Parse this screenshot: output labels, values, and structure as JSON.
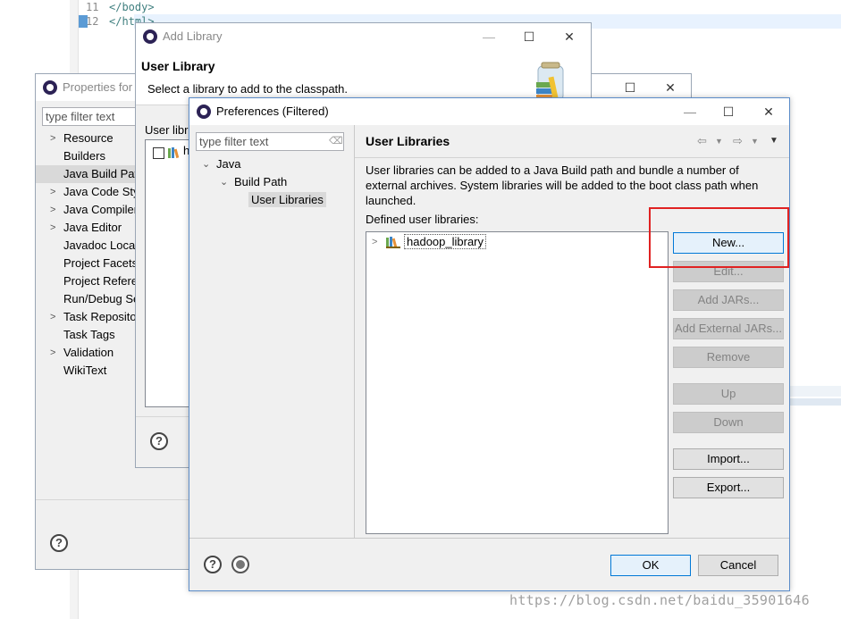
{
  "editor": {
    "lines": [
      {
        "num": "11",
        "code": "</body>"
      },
      {
        "num": "12",
        "code": "</html>"
      }
    ]
  },
  "properties": {
    "title": "Properties for",
    "filter_placeholder": "type filter text",
    "tree": [
      {
        "label": "Resource",
        "expandable": true
      },
      {
        "label": "Builders",
        "expandable": false
      },
      {
        "label": "Java Build Path",
        "expandable": false,
        "selected": true
      },
      {
        "label": "Java Code Style",
        "expandable": true
      },
      {
        "label": "Java Compiler",
        "expandable": true
      },
      {
        "label": "Java Editor",
        "expandable": true
      },
      {
        "label": "Javadoc Location",
        "expandable": false
      },
      {
        "label": "Project Facets",
        "expandable": false
      },
      {
        "label": "Project References",
        "expandable": false
      },
      {
        "label": "Run/Debug Settings",
        "expandable": false
      },
      {
        "label": "Task Repository",
        "expandable": true
      },
      {
        "label": "Task Tags",
        "expandable": false
      },
      {
        "label": "Validation",
        "expandable": true
      },
      {
        "label": "WikiText",
        "expandable": false
      }
    ]
  },
  "add_library": {
    "title": "Add Library",
    "heading": "User Library",
    "subheading": "Select a library to add to the classpath.",
    "list_label": "User libr",
    "item_label": "h"
  },
  "preferences": {
    "title": "Preferences (Filtered)",
    "filter_placeholder": "type filter text",
    "tree": {
      "java": "Java",
      "build_path": "Build Path",
      "user_libraries": "User Libraries"
    },
    "pane_title": "User Libraries",
    "description": "User libraries can be added to a Java Build path and bundle a number of external archives. System libraries will be added to the boot class path when launched.",
    "defined_label": "Defined user libraries:",
    "libraries": [
      "hadoop_library"
    ],
    "buttons": {
      "new": "New...",
      "edit": "Edit...",
      "add_jars": "Add JARs...",
      "add_external_jars": "Add External JARs...",
      "remove": "Remove",
      "up": "Up",
      "down": "Down",
      "import": "Import...",
      "export": "Export...",
      "ok": "OK",
      "cancel": "Cancel"
    }
  },
  "watermark": "https://blog.csdn.net/baidu_35901646",
  "colors": {
    "highlight": "#e02222",
    "focus": "#0078d7",
    "selection": "#d9d9d9"
  }
}
